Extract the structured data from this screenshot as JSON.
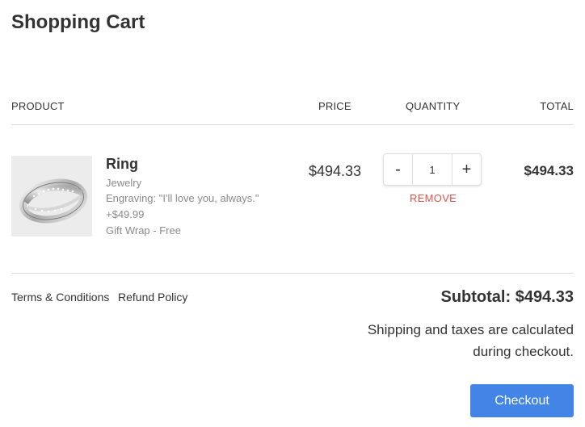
{
  "page": {
    "title": "Shopping Cart"
  },
  "table": {
    "headers": {
      "product": "PRODUCT",
      "price": "PRICE",
      "quantity": "QUANTITY",
      "total": "TOTAL"
    }
  },
  "item": {
    "name": "Ring",
    "category": "Jewelry",
    "engraving": "Engraving: \"I'll love you, always.\"",
    "addon_price": "+$49.99",
    "gift_wrap": "Gift Wrap - Free",
    "price": "$494.33",
    "quantity": "1",
    "decrement": "-",
    "increment": "+",
    "remove_label": "REMOVE",
    "total": "$494.33",
    "image_icon": "ring-product-image"
  },
  "footer": {
    "terms_label": "Terms & Conditions",
    "refund_label": "Refund Policy",
    "subtotal": "Subtotal: $494.33",
    "shipping_note": "Shipping and taxes are calculated during checkout.",
    "checkout_label": "Checkout"
  },
  "colors": {
    "accent": "#4285e6",
    "remove": "#d9534f",
    "muted_text": "#8a8a8a"
  }
}
